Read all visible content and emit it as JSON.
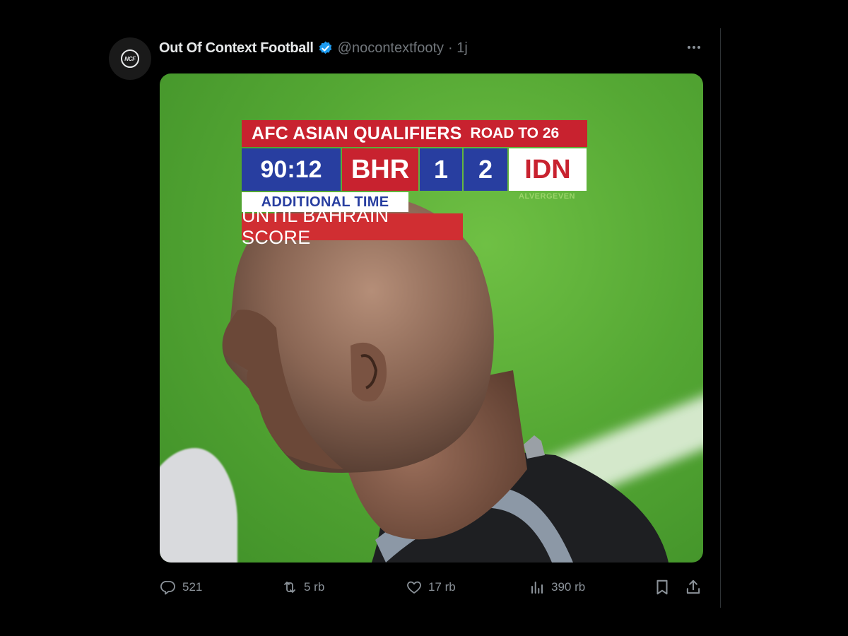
{
  "post": {
    "author": {
      "display_name": "Out Of Context Football",
      "handle": "@nocontextfooty",
      "time": "· 1j",
      "avatar_text": "NCF"
    }
  },
  "media": {
    "scoreboard": {
      "competition": "AFC ASIAN QUALIFIERS",
      "stage": "ROAD TO 26",
      "clock": "90:12",
      "home_team": "BHR",
      "home_score": "1",
      "away_score": "2",
      "away_team": "IDN",
      "credit": "ALVERGEVEN",
      "additional_label": "ADDITIONAL TIME",
      "caption": "UNTIL BAHRAIN SCORE"
    }
  },
  "actions": {
    "replies": "521",
    "reposts": "5 rb",
    "likes": "17 rb",
    "views": "390 rb"
  },
  "colors": {
    "verified": "#1d9bf0",
    "muted_text": "#71767b",
    "scoreboard_red": "#c8222f",
    "scoreboard_blue": "#283ea0"
  },
  "icons": [
    "more-icon",
    "verified-badge-icon",
    "reply-icon",
    "repost-icon",
    "like-icon",
    "views-icon",
    "bookmark-icon",
    "share-icon"
  ]
}
